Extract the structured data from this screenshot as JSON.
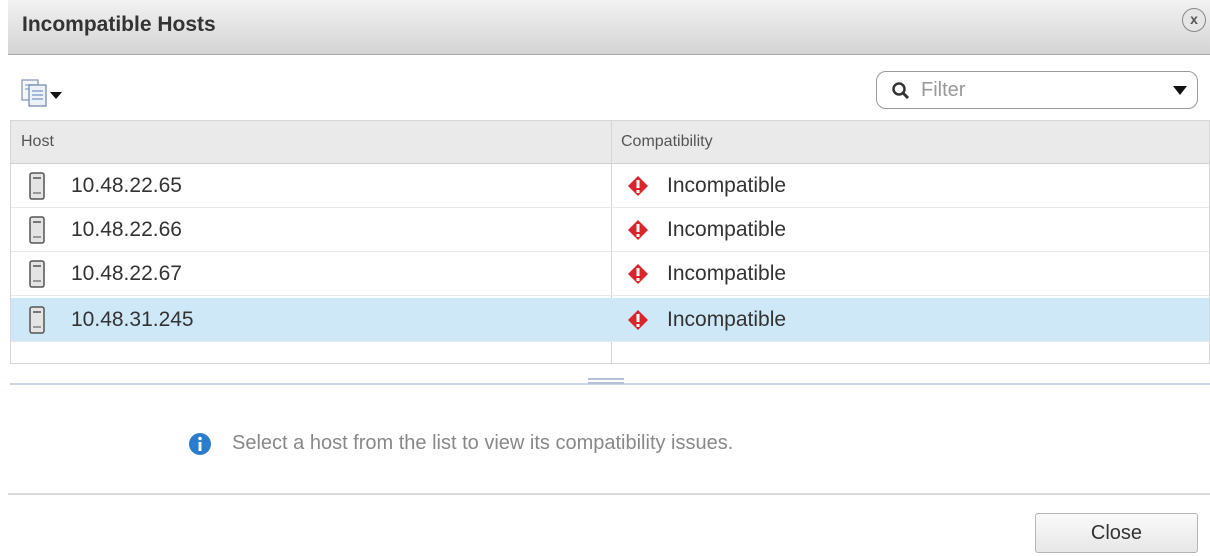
{
  "dialog": {
    "title": "Incompatible Hosts",
    "close_glyph": "x",
    "close_button_label": "Close"
  },
  "toolbar": {
    "export_icon": "export-list-icon",
    "filter_placeholder": "Filter"
  },
  "grid": {
    "columns": [
      "Host",
      "Compatibility"
    ],
    "rows": [
      {
        "host": "10.48.22.65",
        "compatibility": "Incompatible",
        "selected": false
      },
      {
        "host": "10.48.22.66",
        "compatibility": "Incompatible",
        "selected": false
      },
      {
        "host": "10.48.22.67",
        "compatibility": "Incompatible",
        "selected": false
      },
      {
        "host": "10.48.31.245",
        "compatibility": "Incompatible",
        "selected": true
      }
    ]
  },
  "details": {
    "info_message": "Select a host from the list to view its compatibility issues."
  },
  "colors": {
    "selected_row": "#cfe8f8",
    "error_red": "#d9262c",
    "info_blue": "#2a7dcc"
  }
}
